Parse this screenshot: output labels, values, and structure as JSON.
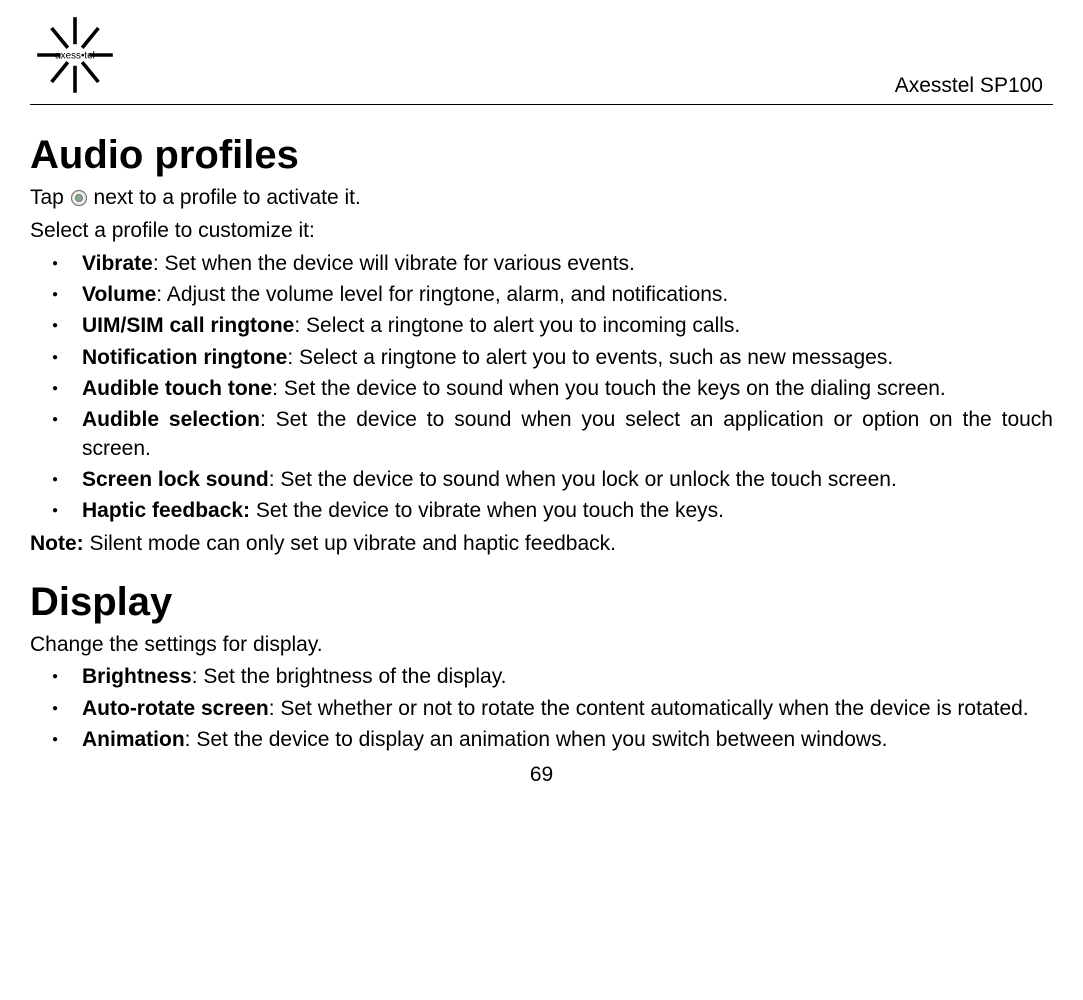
{
  "header": {
    "model": "Axesstel SP100",
    "logo_alt": "axesstel logo"
  },
  "section_audio": {
    "title": "Audio profiles",
    "tap_prefix": "Tap ",
    "tap_suffix": " next to a profile to activate it.",
    "select_line": "Select a profile to customize it:",
    "items": [
      {
        "label": "Vibrate",
        "desc": ": Set when the device will vibrate for various events."
      },
      {
        "label": "Volume",
        "desc": ": Adjust the volume level for ringtone, alarm, and notifications."
      },
      {
        "label": "UIM/SIM call ringtone",
        "desc": ": Select a ringtone to alert you to incoming calls."
      },
      {
        "label": "Notification ringtone",
        "desc": ": Select a ringtone to alert you to events, such as new messages."
      },
      {
        "label": "Audible touch tone",
        "desc": ": Set the device to sound when you touch the keys on the dialing screen."
      },
      {
        "label": "Audible selection",
        "desc": ": Set the device to sound when you select an application or option on the touch screen."
      },
      {
        "label": "Screen lock sound",
        "desc": ": Set the device to sound when you lock or unlock the touch screen."
      },
      {
        "label": "Haptic feedback:",
        "desc": " Set the device to vibrate when you touch the keys."
      }
    ],
    "note_label": "Note:  ",
    "note_text": "Silent mode can only set up vibrate and haptic feedback."
  },
  "section_display": {
    "title": "Display",
    "intro": "Change the settings for display.",
    "items": [
      {
        "label": "Brightness",
        "desc": ": Set the brightness of the display."
      },
      {
        "label": "Auto-rotate screen",
        "desc": ": Set whether or not to rotate the content automatically when the device is rotated."
      },
      {
        "label": "Animation",
        "desc": ": Set the device to display an animation when you switch between windows."
      }
    ]
  },
  "page_number": "69"
}
